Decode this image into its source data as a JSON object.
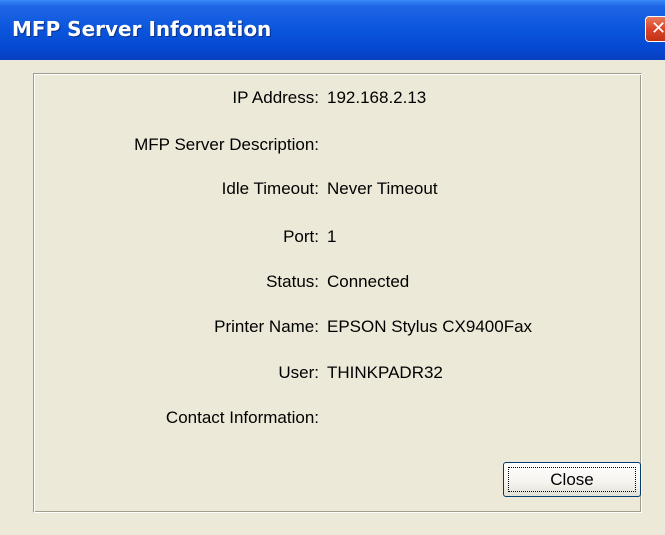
{
  "window": {
    "title": "MFP Server Infomation"
  },
  "fields": [
    {
      "label": "IP Address:",
      "value": "192.168.2.13"
    },
    {
      "label": "MFP Server Description:",
      "value": ""
    },
    {
      "label": "Idle Timeout:",
      "value": "Never Timeout"
    },
    {
      "label": "Port:",
      "value": "1"
    },
    {
      "label": "Status:",
      "value": "Connected"
    },
    {
      "label": "Printer Name:",
      "value": "EPSON Stylus CX9400Fax"
    },
    {
      "label": "User:",
      "value": "THINKPADR32"
    },
    {
      "label": "Contact Information:",
      "value": ""
    }
  ],
  "buttons": {
    "close_label": "Close"
  },
  "icons": {
    "title_close": "close-icon"
  },
  "colors": {
    "titlebar": "#0a55dc",
    "window_bg": "#ece9d8",
    "close_x": "#d9452a"
  }
}
